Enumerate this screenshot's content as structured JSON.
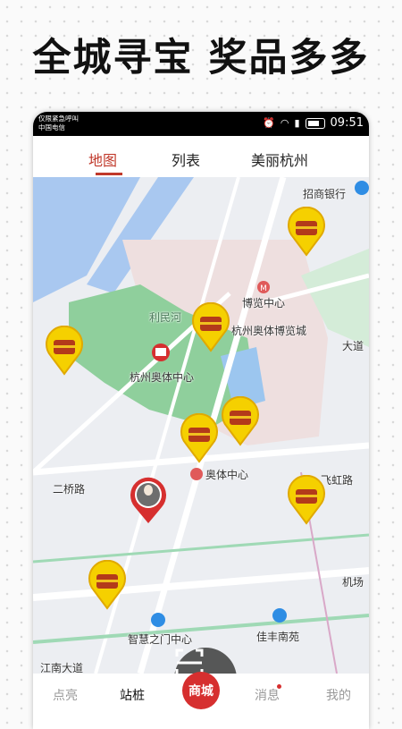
{
  "headline": "全城寻宝  奖品多多",
  "status": {
    "line1": "仅限紧急呼叫",
    "line2": "中国电信",
    "time": "09:51"
  },
  "tabs": {
    "map": "地图",
    "list": "列表",
    "city": "美丽杭州"
  },
  "map_labels": {
    "bank": "招商银行",
    "expo_center": "博览中心",
    "expo_city": "杭州奥体博览城",
    "sports_center": "杭州奥体中心",
    "aoti_center": "奥体中心",
    "river": "利民河",
    "avenue": "大道",
    "bridge_road": "二桥路",
    "feihong_road": "飞虹路",
    "airport": "机场",
    "wisdom_gate": "智慧之门中心",
    "jiafeng": "佳丰南苑",
    "jiangnan": "江南大道"
  },
  "nav": {
    "dianliang": "点亮",
    "zhanzhuang": "站桩",
    "shop": "商城",
    "messages": "消息",
    "mine": "我的"
  },
  "colors": {
    "accent": "#c0392b",
    "treasure": "#f5d000",
    "shop": "#d62f2f"
  },
  "icons": [
    "treasure-chest-icon",
    "scan-icon",
    "location-pin-icon",
    "metro-icon",
    "bank-icon"
  ]
}
